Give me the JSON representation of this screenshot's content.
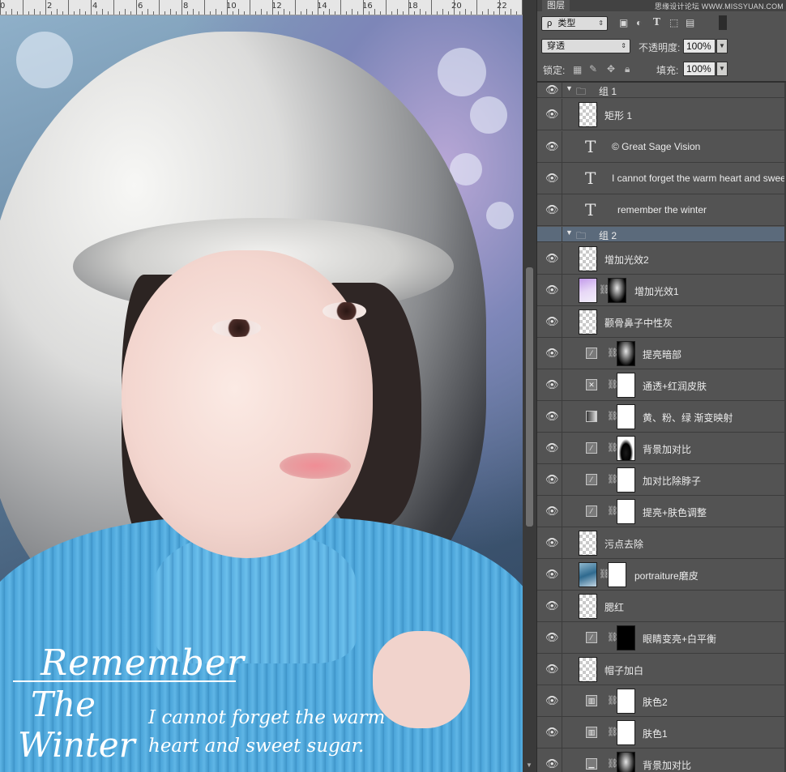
{
  "canvas": {
    "ruler_ticks": [
      "2",
      "4",
      "6",
      "8",
      "10",
      "12",
      "14",
      "16",
      "18",
      "20",
      "22"
    ],
    "title_line1": "Remember",
    "title_line2": "The",
    "title_line3": "Winter",
    "caption_line1": "I cannot forget the warm",
    "caption_line2": "heart and sweet sugar."
  },
  "panel": {
    "tab_label": "图层",
    "watermark": "思缘设计论坛 WWW.MISSYUAN.COM",
    "filter_kind_label": "类型",
    "filter_prefix": "ρ",
    "blend_mode": "穿透",
    "opacity_label": "不透明度:",
    "opacity_value": "100%",
    "lock_label": "锁定:",
    "fill_label": "填充:",
    "fill_value": "100%",
    "icons": {
      "filter_image": "image-filter-icon",
      "filter_adjust": "adjustment-filter-icon",
      "filter_text": "text-filter-icon",
      "filter_shape": "shape-filter-icon",
      "filter_smart": "smart-object-filter-icon"
    }
  },
  "layers": {
    "group1": "组 1",
    "rect1": "矩形 1",
    "text1": "© Great Sage Vision",
    "text2": "I cannot forget the warm heart and sweet s",
    "text3": "remember  the  winter",
    "group2": "组 2",
    "l1": "增加光效2",
    "l2": "增加光效1",
    "l3": "颧骨鼻子中性灰",
    "l4": "提亮暗部",
    "l5": "通透+红润皮肤",
    "l6": "黄、粉、绿 渐变映射",
    "l7": "背景加对比",
    "l8": "加对比除脖子",
    "l9": "提亮+肤色调整",
    "l10": "污点去除",
    "l11": "portraiture磨皮",
    "l12": "腮红",
    "l13": "眼睛变亮+白平衡",
    "l14": "帽子加白",
    "l15": "肤色2",
    "l16": "肤色1",
    "l17": "背景加对比"
  }
}
